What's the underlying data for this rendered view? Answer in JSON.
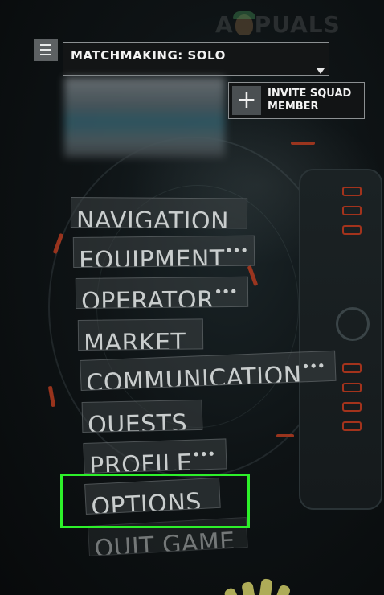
{
  "watermark": {
    "text_left": "A",
    "text_right": "PUALS"
  },
  "header": {
    "matchmaking_label": "MATCHMAKING: SOLO",
    "invite_plus": "+",
    "invite_label": "INVITE SQUAD MEMBER"
  },
  "menu": {
    "items": [
      {
        "label": "NAVIGATION",
        "more": ""
      },
      {
        "label": "EQUIPMENT",
        "more": "•••"
      },
      {
        "label": "OPERATOR",
        "more": "•••"
      },
      {
        "label": "MARKET",
        "more": ""
      },
      {
        "label": "COMMUNICATION",
        "more": "•••"
      },
      {
        "label": "QUESTS",
        "more": ""
      },
      {
        "label": "PROFILE",
        "more": "•••"
      },
      {
        "label": "OPTIONS",
        "more": ""
      },
      {
        "label": "QUIT GAME",
        "more": ""
      }
    ]
  },
  "colors": {
    "highlight": "#2df02a",
    "accent_red": "#b23a1e",
    "menu_text": "#c9cdcd"
  },
  "icons": {
    "menu": "hamburger-icon",
    "dropdown": "caret-down-icon",
    "invite": "plus-icon"
  }
}
